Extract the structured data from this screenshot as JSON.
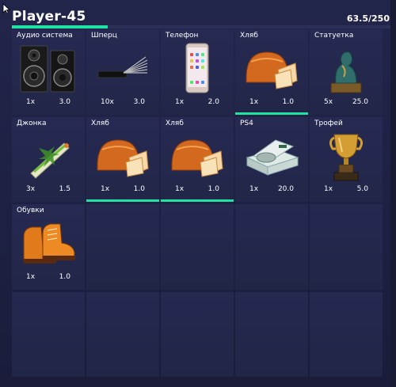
{
  "header": {
    "title": "Player-45",
    "weight": "63.5/250",
    "weight_progress": 0.254
  },
  "colors": {
    "accent": "#1fe3a3",
    "cell_bg": "#262a52",
    "panel_bg": "#1d2042"
  },
  "inventory": {
    "slots": [
      {
        "name": "Аудио система",
        "qty": "1x",
        "weight": "3.0",
        "icon": "speakers-icon",
        "selected": false
      },
      {
        "name": "Шперц",
        "qty": "10x",
        "weight": "3.0",
        "icon": "lockpick-icon",
        "selected": false
      },
      {
        "name": "Телефон",
        "qty": "1x",
        "weight": "2.0",
        "icon": "phone-icon",
        "selected": false
      },
      {
        "name": "Хляб",
        "qty": "1x",
        "weight": "1.0",
        "icon": "bread-icon",
        "selected": true
      },
      {
        "name": "Статуетка",
        "qty": "5x",
        "weight": "25.0",
        "icon": "statue-icon",
        "selected": false
      },
      {
        "name": "Джонка",
        "qty": "3x",
        "weight": "1.5",
        "icon": "joint-icon",
        "selected": false
      },
      {
        "name": "Хляб",
        "qty": "1x",
        "weight": "1.0",
        "icon": "bread-icon",
        "selected": true
      },
      {
        "name": "Хляб",
        "qty": "1x",
        "weight": "1.0",
        "icon": "bread-icon",
        "selected": true
      },
      {
        "name": "PS4",
        "qty": "1x",
        "weight": "20.0",
        "icon": "console-icon",
        "selected": false
      },
      {
        "name": "Трофей",
        "qty": "1x",
        "weight": "5.0",
        "icon": "trophy-icon",
        "selected": false
      },
      {
        "name": "Обувки",
        "qty": "1x",
        "weight": "1.0",
        "icon": "boots-icon",
        "selected": false
      }
    ],
    "total_slots": 20
  }
}
